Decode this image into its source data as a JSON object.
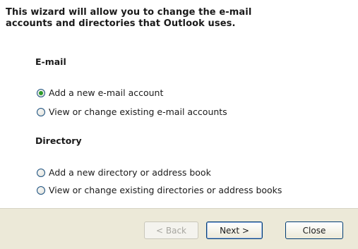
{
  "wizard": {
    "intro_line1": "This wizard will allow you to change the e-mail",
    "intro_line2": "accounts and directories that Outlook uses."
  },
  "email_section": {
    "title": "E-mail",
    "options": [
      {
        "label": "Add a new e-mail account",
        "selected": true
      },
      {
        "label": "View or change existing e-mail accounts",
        "selected": false
      }
    ]
  },
  "directory_section": {
    "title": "Directory",
    "options": [
      {
        "label": "Add a new directory or address book",
        "selected": false
      },
      {
        "label": "View or change existing directories or address books",
        "selected": false
      }
    ]
  },
  "buttons": {
    "back_label": "< Back",
    "next_label": "Next >",
    "close_label": "Close"
  }
}
